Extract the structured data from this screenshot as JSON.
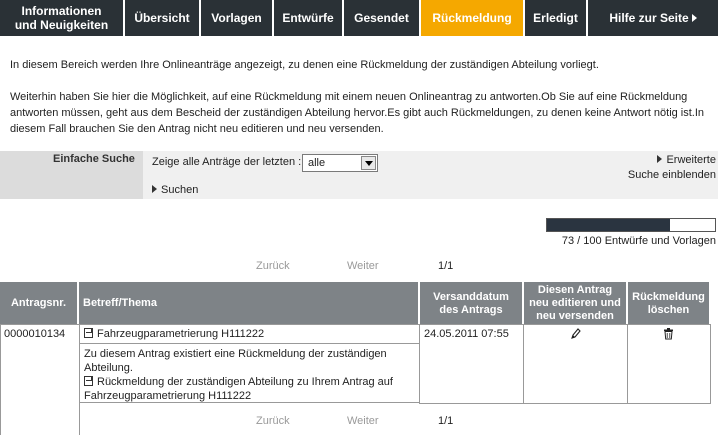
{
  "nav": {
    "items": [
      {
        "label": "Informationen und Neuigkeiten"
      },
      {
        "label": "Übersicht"
      },
      {
        "label": "Vorlagen"
      },
      {
        "label": "Entwürfe"
      },
      {
        "label": "Gesendet"
      },
      {
        "label": "Rückmeldung"
      },
      {
        "label": "Erledigt"
      },
      {
        "label": "Hilfe zur Seite"
      }
    ],
    "active": "Rückmeldung",
    "colors": {
      "bar": "#2a3136",
      "active": "#f5a800"
    }
  },
  "intro": {
    "line1": "In diesem Bereich werden Ihre Onlineanträge angezeigt, zu denen eine Rückmeldung der zuständigen Abteilung vorliegt.",
    "p2_line1": "Weiterhin haben Sie hier die Möglichkeit, auf eine Rückmeldung mit einem neuen Onlineantrag zu antworten.Ob Sie auf eine Rückmeldung",
    "p2_line2": "antworten müssen, geht aus dem Bescheid der zuständigen Abteilung hervor.Es gibt auch Rückmeldungen, zu denen keine Antwort nötig ist.In",
    "p2_line3": "diesem Fall brauchen Sie den Antrag nicht neu editieren und neu versenden."
  },
  "search": {
    "title": "Einfache Suche",
    "label": "Zeige alle Anträge der letzten :",
    "select_value": "alle",
    "submit": "Suchen",
    "advanced_line1": "Erweiterte",
    "advanced_line2": "Suche einblenden"
  },
  "progress": {
    "used": 73,
    "total": 100,
    "fraction": 0.73,
    "text": "73 / 100 Entwürfe und Vorlagen"
  },
  "pager": {
    "back": "Zurück",
    "next": "Weiter",
    "page": "1/1"
  },
  "table": {
    "headers": {
      "nr": "Antragsnr.",
      "subject": "Betreff/Thema",
      "date_line1": "Versanddatum",
      "date_line2": "des Antrags",
      "edit_line1": "Diesen Antrag",
      "edit_line2": "neu editieren und",
      "edit_line3": "neu versenden",
      "delete_line1": "Rückmeldung",
      "delete_line2": "löschen"
    },
    "rows": [
      {
        "nr": "0000010134",
        "subject": "Fahrzeugparametrierung H111222",
        "note_line1": "Zu diesem Antrag existiert eine Rückmeldung der zuständigen",
        "note_line2": "Abteilung.",
        "reply_line1": "Rückmeldung der zuständigen Abteilung zu Ihrem Antrag auf",
        "reply_line2": "Fahrzeugparametrierung H111222",
        "date": "24.05.2011 07:55",
        "edit_icon": "pencil-icon",
        "delete_icon": "trash-icon"
      }
    ]
  }
}
